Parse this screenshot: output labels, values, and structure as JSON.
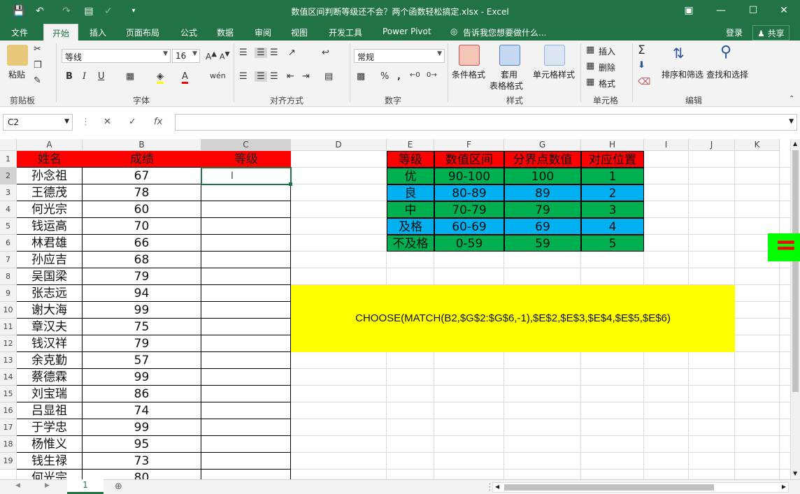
{
  "window": {
    "title": "数值区间判断等级还不会？两个函数轻松搞定.xlsx - Excel"
  },
  "tabs": [
    "文件",
    "开始",
    "插入",
    "页面布局",
    "公式",
    "数据",
    "审阅",
    "视图",
    "开发工具",
    "Power Pivot"
  ],
  "tell_me": "告诉我您想要做什么...",
  "account": {
    "login": "登录",
    "share": "共享"
  },
  "ribbon": {
    "clipboard": {
      "paste": "粘贴",
      "label": "剪贴板"
    },
    "font": {
      "name": "等线",
      "size": "16",
      "label": "字体",
      "bold": "B",
      "italic": "I",
      "underline": "U"
    },
    "alignment": {
      "label": "对齐方式"
    },
    "number": {
      "format": "常规",
      "label": "数字",
      "percent": "%",
      "comma": ","
    },
    "styles": {
      "conditional": "条件格式",
      "table1": "套用",
      "table2": "表格格式",
      "cell_styles": "单元格样式",
      "label": "样式"
    },
    "cells": {
      "insert": "插入",
      "delete": "删除",
      "format": "格式",
      "label": "单元格"
    },
    "editing": {
      "sort": "排序和筛选",
      "find": "查找和选择",
      "label": "编辑"
    }
  },
  "formula_bar": {
    "name_box": "C2",
    "fx": "fx",
    "content": ""
  },
  "columns": [
    "A",
    "B",
    "C",
    "D",
    "E",
    "F",
    "G",
    "H",
    "I",
    "J",
    "K"
  ],
  "rows": [
    "1",
    "2",
    "3",
    "4",
    "5",
    "6",
    "7",
    "8",
    "9",
    "10",
    "11",
    "12",
    "13",
    "14",
    "15",
    "16",
    "17",
    "18",
    "19"
  ],
  "sheet": {
    "headers": [
      "姓名",
      "成绩",
      "等级"
    ],
    "students": [
      [
        "孙念祖",
        "67"
      ],
      [
        "王德茂",
        "78"
      ],
      [
        "何光宗",
        "60"
      ],
      [
        "钱运高",
        "70"
      ],
      [
        "林君雄",
        "66"
      ],
      [
        "孙应吉",
        "68"
      ],
      [
        "吴国梁",
        "79"
      ],
      [
        "张志远",
        "94"
      ],
      [
        "谢大海",
        "99"
      ],
      [
        "章汉夫",
        "75"
      ],
      [
        "钱汉祥",
        "79"
      ],
      [
        "余克勤",
        "57"
      ],
      [
        "蔡德霖",
        "99"
      ],
      [
        "刘宝瑞",
        "86"
      ],
      [
        "吕显祖",
        "74"
      ],
      [
        "于学忠",
        "99"
      ],
      [
        "杨惟义",
        "95"
      ],
      [
        "钱生禄",
        "73"
      ],
      [
        "何光宗",
        "80"
      ]
    ]
  },
  "lookup": {
    "headers": [
      "等级",
      "数值区间",
      "分界点数值",
      "对应位置"
    ],
    "rows": [
      [
        "优",
        "90-100",
        "100",
        "1"
      ],
      [
        "良",
        "80-89",
        "89",
        "2"
      ],
      [
        "中",
        "70-79",
        "79",
        "3"
      ],
      [
        "及格",
        "60-69",
        "69",
        "4"
      ],
      [
        "不及格",
        "0-59",
        "59",
        "5"
      ]
    ]
  },
  "formula_note": "CHOOSE(MATCH(B2,$G$2:$G$6,-1),$E$2,$E$3,$E$4,$E$5,$E$6)",
  "side_badge": "=",
  "sheet_tabs": [
    "1"
  ],
  "colors": {
    "excel_green": "#217346",
    "header_red": "#ff0000",
    "row_green": "#00b050",
    "row_blue": "#00b0f0",
    "yellow": "#ffff00"
  }
}
